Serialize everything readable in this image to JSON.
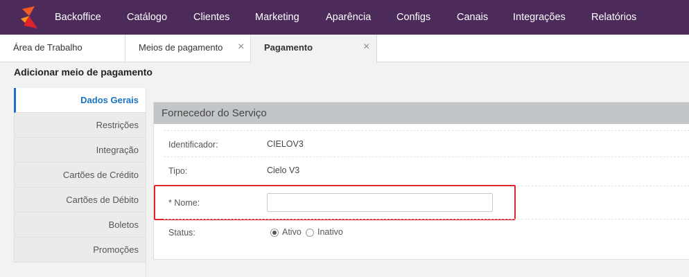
{
  "nav": {
    "items": [
      "Backoffice",
      "Catálogo",
      "Clientes",
      "Marketing",
      "Aparência",
      "Configs",
      "Canais",
      "Integrações",
      "Relatórios"
    ],
    "bg_color": "#4c2a5a",
    "logo_colors": [
      "#f15a24",
      "#e0232b"
    ]
  },
  "tabs": [
    {
      "label": "Área de Trabalho"
    },
    {
      "label": "Meios de pagamento",
      "close": "×"
    },
    {
      "label": "Pagamento",
      "close": "×"
    }
  ],
  "page_title": "Adicionar meio de pagamento",
  "side_menu": {
    "items": [
      "Dados Gerais",
      "Restrições",
      "Integração",
      "Cartões de Crédito",
      "Cartões de Débito",
      "Boletos",
      "Promoções"
    ],
    "active": "Dados Gerais",
    "accent": "#1a73c2"
  },
  "panel": {
    "title": "Fornecedor do Serviço",
    "fields": {
      "identifier": {
        "label": "Identificador:",
        "value": "CIELOV3"
      },
      "type": {
        "label": "Tipo:",
        "value": "Cielo V3"
      },
      "name": {
        "label": "* Nome:",
        "value": ""
      },
      "status": {
        "label": "Status:",
        "options": [
          "Ativo",
          "Inativo"
        ],
        "selected": "Ativo"
      }
    },
    "highlight_color": "#e0232b"
  }
}
